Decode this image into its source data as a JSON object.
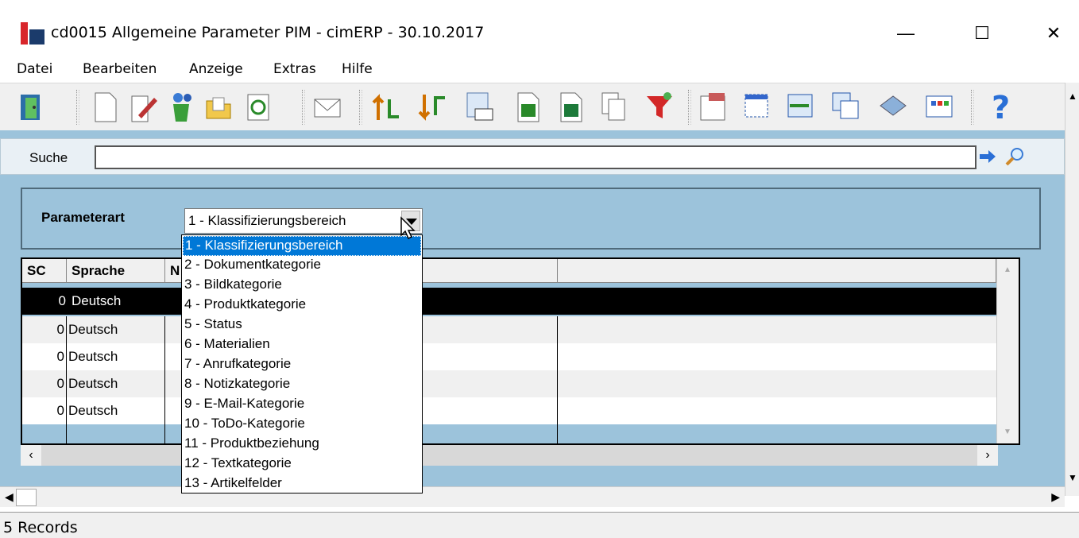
{
  "window": {
    "title": "cd0015 Allgemeine Parameter PIM - cimERP - 30.10.2017",
    "minimize": "—",
    "maximize": "☐",
    "close": "✕"
  },
  "menu": [
    "Datei",
    "Bearbeiten",
    "Anzeige",
    "Extras",
    "Hilfe"
  ],
  "search": {
    "label": "Suche",
    "value": ""
  },
  "param": {
    "label": "Parameterart",
    "value": "1 - Klassifizierungsbereich"
  },
  "grid": {
    "headers": [
      "SC",
      "Sprache",
      "N"
    ],
    "rows": [
      {
        "sc": "0",
        "sprache": "Deutsch",
        "selected": true
      },
      {
        "sc": "0",
        "sprache": "Deutsch",
        "selected": false
      },
      {
        "sc": "0",
        "sprache": "Deutsch",
        "selected": false
      },
      {
        "sc": "0",
        "sprache": "Deutsch",
        "selected": false
      },
      {
        "sc": "0",
        "sprache": "Deutsch",
        "selected": false
      }
    ]
  },
  "dropdown": [
    "1 - Klassifizierungsbereich",
    "2 - Dokumentkategorie",
    "3 - Bildkategorie",
    "4 - Produktkategorie",
    "5 - Status",
    "6 - Materialien",
    "7 - Anrufkategorie",
    "8 - Notizkategorie",
    "9 - E-Mail-Kategorie",
    "10 - ToDo-Kategorie",
    "11 - Produktbeziehung",
    "12 - Textkategorie",
    "13 - Artikelfelder"
  ],
  "status": {
    "text": "5 Records"
  },
  "toolbar_icons": [
    "exit-icon",
    "new-document-icon",
    "edit-icon",
    "recycle-icon",
    "open-folder-icon",
    "refresh-icon",
    "mail-icon",
    "sort-ascending-icon",
    "sort-descending-icon",
    "number-format-icon",
    "export-icon",
    "excel-icon",
    "copy-icon",
    "filter-icon",
    "properties-icon",
    "new-window-icon",
    "transfer-icon",
    "windows-icon",
    "book-icon",
    "grid-view-icon",
    "help-icon"
  ]
}
